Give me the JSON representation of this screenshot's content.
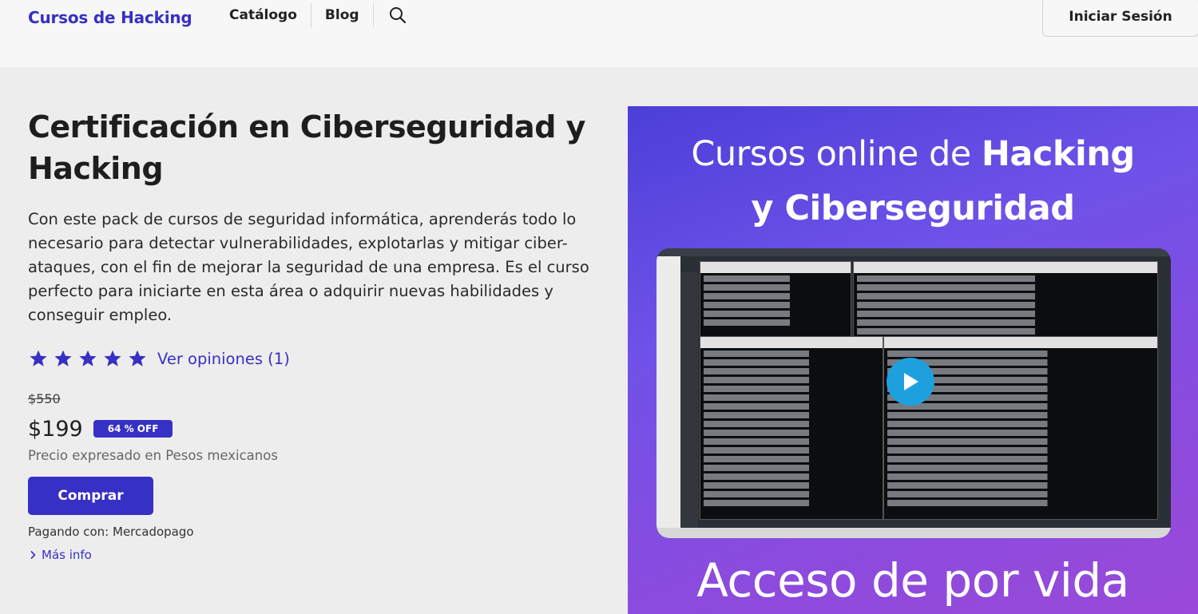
{
  "header": {
    "brand": "Cursos de Hacking",
    "nav": [
      "Catálogo",
      "Blog"
    ],
    "login_label": "Iniciar Sesión"
  },
  "product": {
    "title": "Certificación en Ciberseguridad y Hacking",
    "description": "Con este pack de cursos de seguridad informática, aprenderás todo lo necesario para detectar vulnerabilidades, explotarlas y mitigar ciber-ataques, con el fin de mejorar la seguridad de una empresa. Es el curso perfecto para iniciarte en esta área o adquirir nuevas habilidades y conseguir empleo.",
    "rating_stars": 5,
    "reviews_link": "Ver opiniones (1)",
    "old_price": "$550",
    "price": "$199",
    "discount": "64 % OFF",
    "price_note": "Precio expresado en Pesos mexicanos",
    "buy_label": "Comprar",
    "payment": "Pagando con: Mercadopago",
    "more_info": "Más info"
  },
  "media": {
    "title_line1_regular": "Cursos online de ",
    "title_line1_bold": "Hacking",
    "title_line2": "y Ciberseguridad",
    "footer": "Acceso de por vida"
  },
  "colors": {
    "brand": "#3730c4",
    "play": "#1fa0de"
  }
}
